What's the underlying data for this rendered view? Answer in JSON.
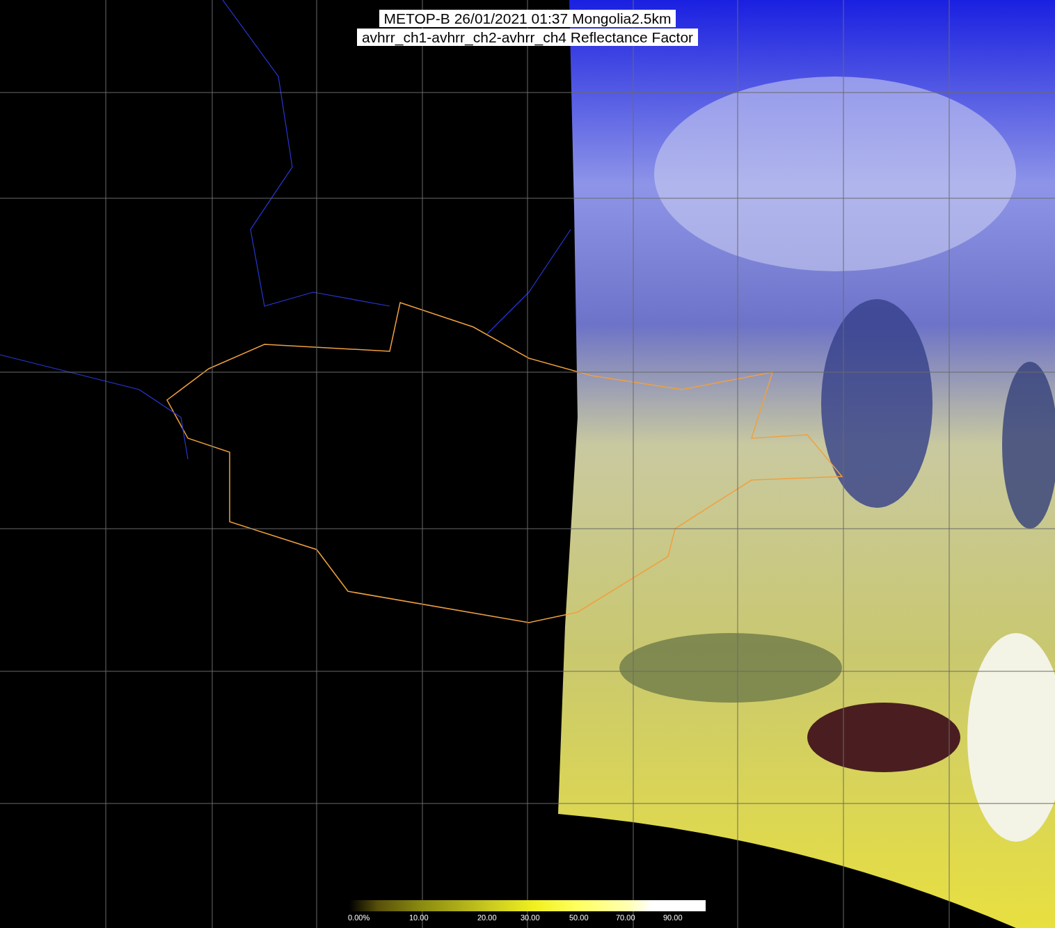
{
  "title": {
    "lines": [
      "METOP-B 26/01/2021 01:37 Mongolia2.5km",
      "avhrr_ch1-avhrr_ch2-avhrr_ch4 Reflectance Factor"
    ]
  },
  "colorbar": {
    "labels": [
      "0.00%",
      "10.00",
      "20.00",
      "30.00",
      "50.00",
      "70.00",
      "90.00"
    ]
  }
}
